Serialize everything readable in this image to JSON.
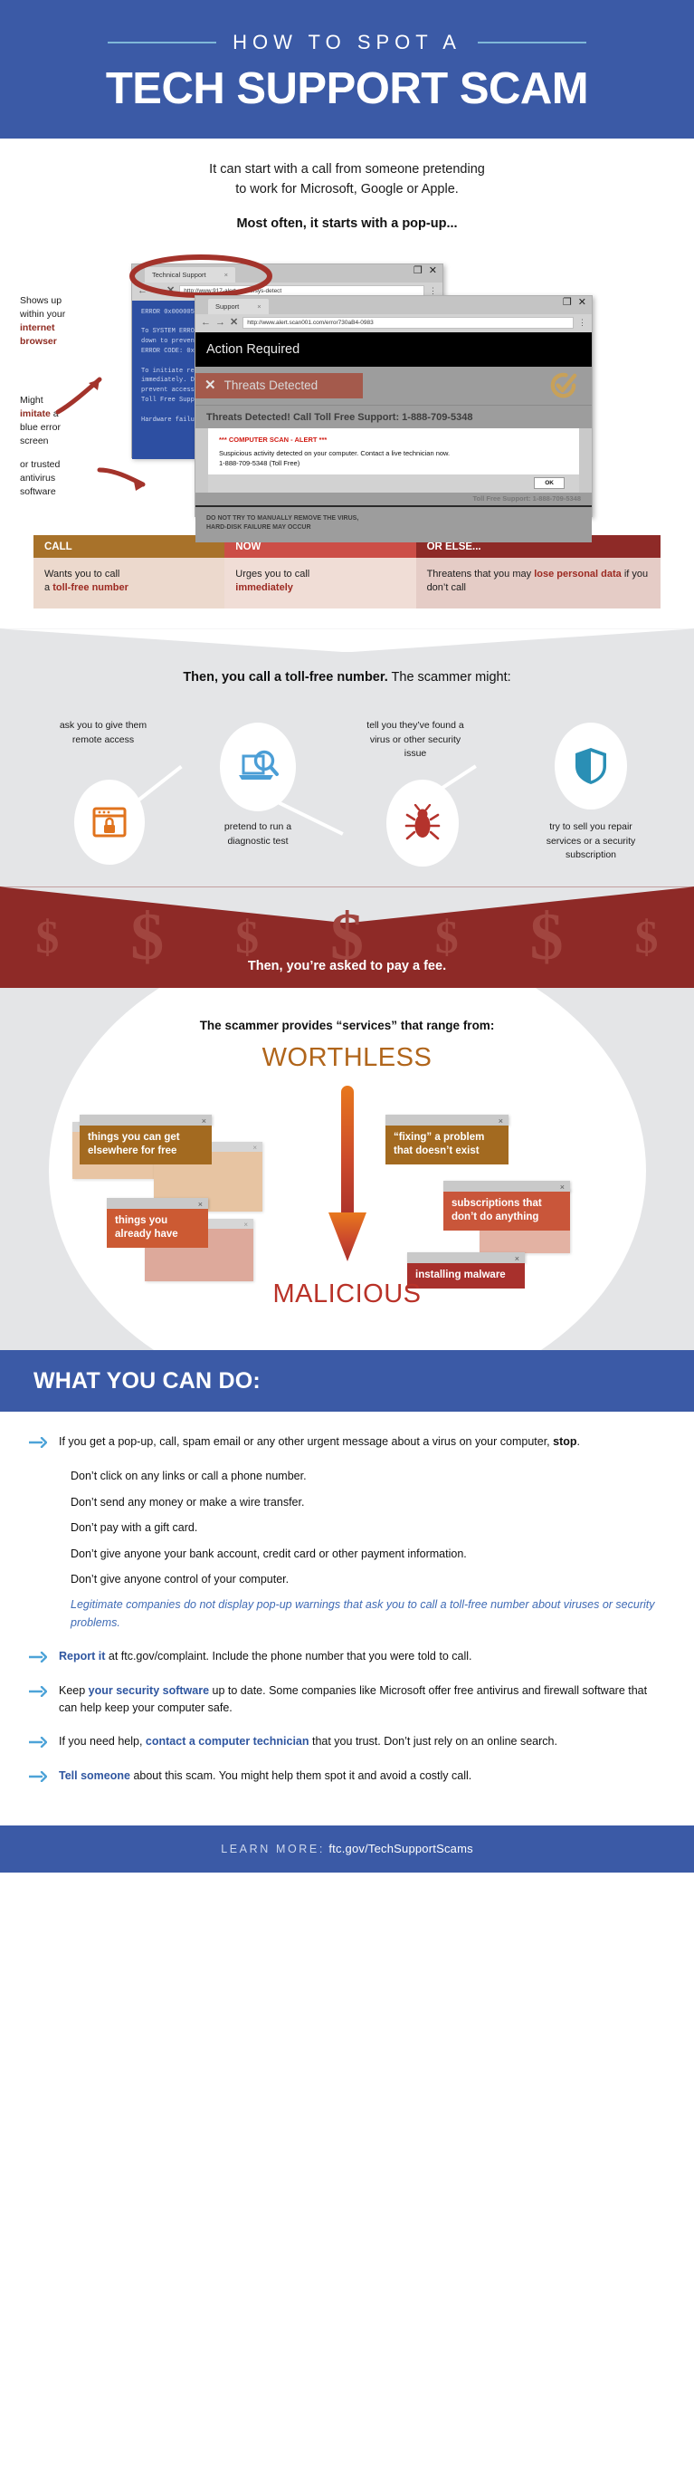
{
  "header": {
    "eyebrow": "HOW TO SPOT A",
    "title": "TECH SUPPORT SCAM",
    "bg_color": "#3b5aa6"
  },
  "intro": {
    "line1": "It can start with a call from someone pretending",
    "line2": "to work for Microsoft, Google or Apple.",
    "most_often": "Most often, it starts with a pop-up..."
  },
  "annotations": {
    "browser": {
      "plain1": "Shows up",
      "plain2": "within your",
      "red1": "internet",
      "red2": "browser"
    },
    "blue": {
      "l1_pre": "Might",
      "l1_red": "imitate",
      "l1_post": " a",
      "l2": "blue error",
      "l3": "screen"
    },
    "antivirus": {
      "l1": "or trusted",
      "l2": "antivirus",
      "l3": "software"
    }
  },
  "blue_window": {
    "tab_title": "Technical Support",
    "tab_close": "×",
    "url": "http://www.917-alert.online/sys-detect",
    "restore_icon": "restore-icon",
    "close_icon": "✕",
    "back": "←",
    "forward": "→",
    "stop": "✕",
    "menu": "⋮",
    "code_lines": [
      "ERROR 0x0000050-  PAGE_FAULT_IN_NONPAGED_AREA",
      "",
      "To SYSTEM ERROR detected. Windows has been shut",
      "down to prevent damage to your computer.",
      "ERROR CODE: 0x000000ED UNMOUNTABLE_BOOT_VOLUME",
      "",
      "To initiate recovery, contact technical support",
      "immediately. Do not restart your machine or you may",
      "prevent access to your files.",
      "Toll Free Support: 1-888-709-5348",
      "",
      "Hardware failure imminent. Dumping physical memory..."
    ]
  },
  "av_window": {
    "tab_title": "Support",
    "tab_close": "×",
    "url": "http://www.alert.scan001.com/error730aB4-0983",
    "restore_icon": "restore-icon",
    "close_icon": "✕",
    "back": "←",
    "forward": "→",
    "stop": "✕",
    "menu": "⋮",
    "action_required": "Action Required",
    "threats_button": "Threats Detected",
    "threats_x": "✕",
    "headline": "Threats Detected!  Call Toll Free Support: 1-888-709-5348",
    "dialog_title": "*** COMPUTER SCAN - ALERT ***",
    "dialog_line1": "Suspicious activity detected on your computer. Contact a live technician now.",
    "dialog_line2": "1-888-709-5348 (Toll Free)",
    "ok_label": "OK",
    "toll_small": "Toll Free Support: 1-888-709-5348",
    "bottom_line1": "DO NOT TRY TO MANUALLY REMOVE THE VIRUS,",
    "bottom_line2": "HARD-DISK FAILURE MAY OCCUR"
  },
  "tactics": {
    "columns": [
      {
        "head": "CALL",
        "head_color": "#a8722a",
        "body_color": "#ecd9cd",
        "text_pre": "Wants you to call",
        "text_break": "a ",
        "text_bold": "toll-free number",
        "text_post": ""
      },
      {
        "head": "NOW",
        "head_color": "#cc4e47",
        "body_color": "#f0ddd6",
        "text_pre": "Urges you to call",
        "text_break": "",
        "text_bold": "immediately",
        "text_post": ""
      },
      {
        "head": "OR ELSE...",
        "head_color": "#8e2a27",
        "body_color": "#e5ccc6",
        "text_pre": "Threatens that you may ",
        "text_bold": "lose personal data",
        "text_post": " if you don’t call"
      }
    ]
  },
  "scammer_might": {
    "lead_bold": "Then, you call a toll-free number.",
    "lead_rest": " The scammer might:",
    "items": [
      {
        "icon": "browser-lock-icon",
        "icon_color": "#e0731d",
        "caption": "ask you to give them remote access"
      },
      {
        "icon": "laptop-magnifier-icon",
        "icon_color": "#4b9ed6",
        "caption": "pretend to run a diagnostic test"
      },
      {
        "icon": "bug-icon",
        "icon_color": "#b4332c",
        "caption": "tell you they’ve found a virus or other security issue"
      },
      {
        "icon": "shield-icon",
        "icon_color": "#2a8fb5",
        "caption": "try to sell you repair services or a security subscription"
      }
    ]
  },
  "fee_band": {
    "text": "Then, you’re asked to pay a fee.",
    "bg_color": "#8e2a27",
    "dollar_glyph": "$"
  },
  "services": {
    "lead": "The scammer provides “services” that range from:",
    "top_label": "WORTHLESS",
    "top_color": "#b0651b",
    "bottom_label": "MALICIOUS",
    "bottom_color": "#b93228",
    "close_glyph": "×",
    "cards": [
      {
        "label": "things you can get elsewhere for free",
        "color": "#a36a20"
      },
      {
        "label": "things you already have",
        "color": "#cc5a33"
      },
      {
        "label": "“fixing” a problem that doesn’t exist",
        "color": "#a36a20"
      },
      {
        "label": "subscriptions that don’t do anything",
        "color": "#c9563a"
      },
      {
        "label": "installing malware",
        "color": "#a8302c"
      }
    ]
  },
  "what_you_can_do": {
    "title": "WHAT YOU CAN DO:",
    "arrow_glyph": "→",
    "arrow_color": "#4da3d8",
    "tips": [
      {
        "pre": "If you get a pop-up, call, spam email or any other urgent message about a virus on your computer, ",
        "bold_black": "stop",
        "post": ".",
        "sub": [
          "Don’t click on any links or call a phone number.",
          "Don’t send any money or make a wire transfer.",
          "Don’t pay with a gift card.",
          "Don’t give anyone your bank account, credit card or other payment information.",
          "Don’t give anyone control of your computer."
        ],
        "italic_note": "Legitimate companies do not display pop-up warnings that ask you to call a toll-free number about viruses or security problems."
      },
      {
        "bold": "Report it",
        "post": " at ftc.gov/complaint. Include the phone number that you were told to call."
      },
      {
        "pre": "Keep ",
        "bold": "your security software",
        "post": " up to date. Some companies like Microsoft offer free antivirus and firewall software that can help keep your computer safe."
      },
      {
        "pre": "If you need help, ",
        "bold": "contact a computer technician",
        "post": " that you trust. Don’t just rely on an online search."
      },
      {
        "bold": "Tell someone",
        "post": " about this scam. You might help them spot it and avoid a costly call."
      }
    ]
  },
  "footer": {
    "learn_more": "LEARN MORE:",
    "url": "ftc.gov/TechSupportScams"
  }
}
